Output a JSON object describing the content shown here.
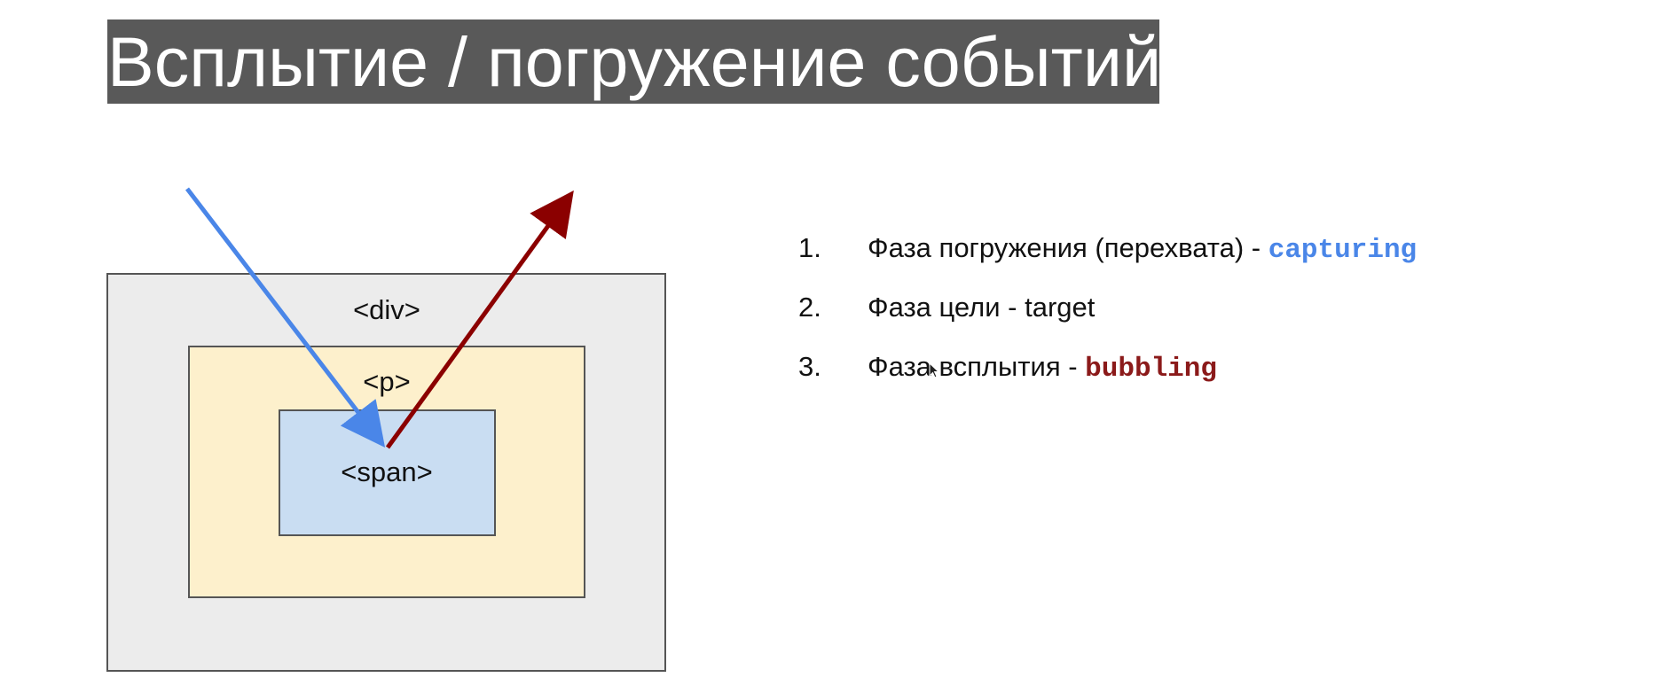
{
  "title": "Всплытие / погружение событий",
  "diagram": {
    "div_label": "<div>",
    "p_label": "<p>",
    "span_label": "<span>",
    "colors": {
      "capturing_arrow": "#4a86e8",
      "bubbling_arrow": "#8b0000",
      "div_fill": "#ececec",
      "p_fill": "#fdf0cc",
      "span_fill": "#c9ddf2"
    }
  },
  "phases": [
    {
      "number": "1.",
      "text": "Фаза погружения (перехвата) - ",
      "code": "capturing"
    },
    {
      "number": "2.",
      "text": "Фаза цели - target",
      "code": ""
    },
    {
      "number": "3.",
      "text": "Фаза всплытия - ",
      "code": "bubbling"
    }
  ]
}
